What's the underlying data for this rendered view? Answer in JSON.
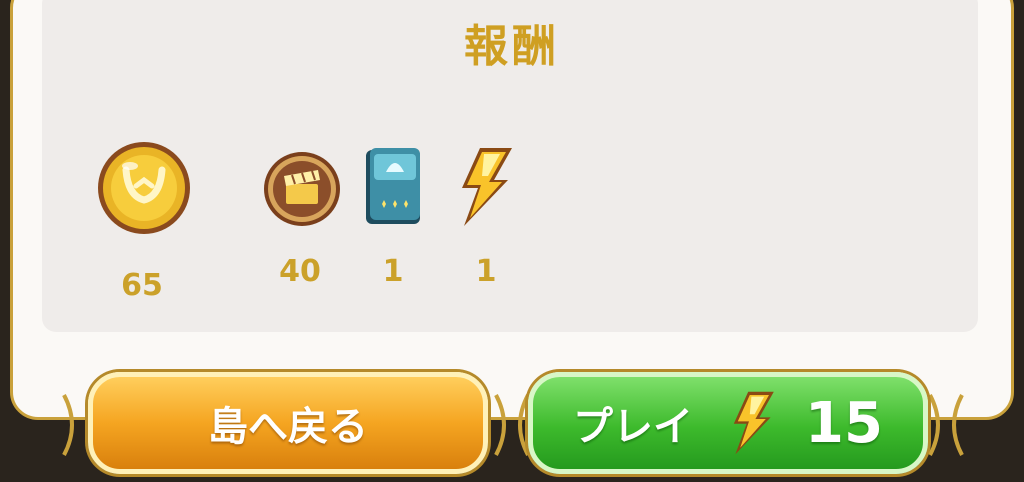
{
  "title": "報酬",
  "rewards": [
    {
      "icon": "gold-coin-icon",
      "count": "65"
    },
    {
      "icon": "bronze-clapperboard-coin-icon",
      "count": "40"
    },
    {
      "icon": "card-pack-icon",
      "count": "1"
    },
    {
      "icon": "lightning-bolt-icon",
      "count": "1"
    }
  ],
  "buttons": {
    "back_label": "島へ戻る",
    "play_label": "プレイ",
    "play_cost": "15"
  },
  "colors": {
    "gold_text": "#cba12a",
    "orange_button": "#f5a521",
    "green_button": "#3dba2c"
  }
}
